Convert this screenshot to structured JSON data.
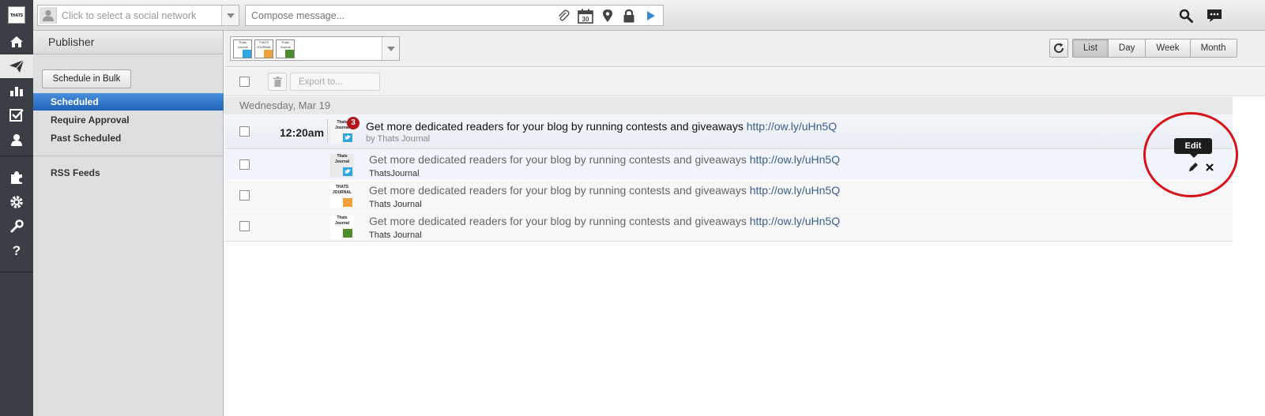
{
  "rail": {
    "logo_text": "THATS JOURNAL",
    "items": [
      {
        "name": "home-icon"
      },
      {
        "name": "publisher-icon"
      },
      {
        "name": "analytics-icon"
      },
      {
        "name": "assignments-icon"
      },
      {
        "name": "contacts-icon"
      },
      {
        "name": "apps-icon"
      },
      {
        "name": "settings-icon"
      },
      {
        "name": "tools-icon"
      },
      {
        "name": "help-icon"
      }
    ]
  },
  "topbar": {
    "social_network_placeholder": "Click to select a social network",
    "compose_placeholder": "Compose message...",
    "calendar_day": "30"
  },
  "publisher": {
    "title": "Publisher",
    "bulk_button": "Schedule in Bulk",
    "nav": [
      "Scheduled",
      "Require Approval",
      "Past Scheduled"
    ],
    "rss": "RSS Feeds"
  },
  "filter": {
    "profiles": [
      {
        "label": "Thats Journal",
        "network": "twitter"
      },
      {
        "label": "THATS JOURNAL",
        "network": "other"
      },
      {
        "label": "Thats Journal",
        "network": "linkedin"
      }
    ]
  },
  "views": [
    "List",
    "Day",
    "Week",
    "Month"
  ],
  "actions": {
    "export_label": "Export to..."
  },
  "day_header": "Wednesday, Mar 19",
  "group": {
    "time": "12:20am",
    "count": "3",
    "thumb_label": "Thats Journal",
    "message_text": "Get more dedicated readers for your blog by running contests and giveaways",
    "message_link": "http://ow.ly/uHn5Q",
    "by": "by Thats Journal"
  },
  "posts": [
    {
      "text": "Get more dedicated readers for your blog by running contests and giveaways",
      "link": "http://ow.ly/uHn5Q",
      "author": "ThatsJournal",
      "thumb": "Thats Journal"
    },
    {
      "text": "Get more dedicated readers for your blog by running contests and giveaways",
      "link": "http://ow.ly/uHn5Q",
      "author": "Thats Journal",
      "thumb": "THATS JOURNAL"
    },
    {
      "text": "Get more dedicated readers for your blog by running contests and giveaways",
      "link": "http://ow.ly/uHn5Q",
      "author": "Thats Journal",
      "thumb": "Thats Journal"
    }
  ],
  "tooltip": "Edit",
  "colors": {
    "active_nav": "#2a6fc6",
    "link": "#3b5e8c",
    "badge": "#b3151b",
    "annotation": "#d9121a"
  }
}
